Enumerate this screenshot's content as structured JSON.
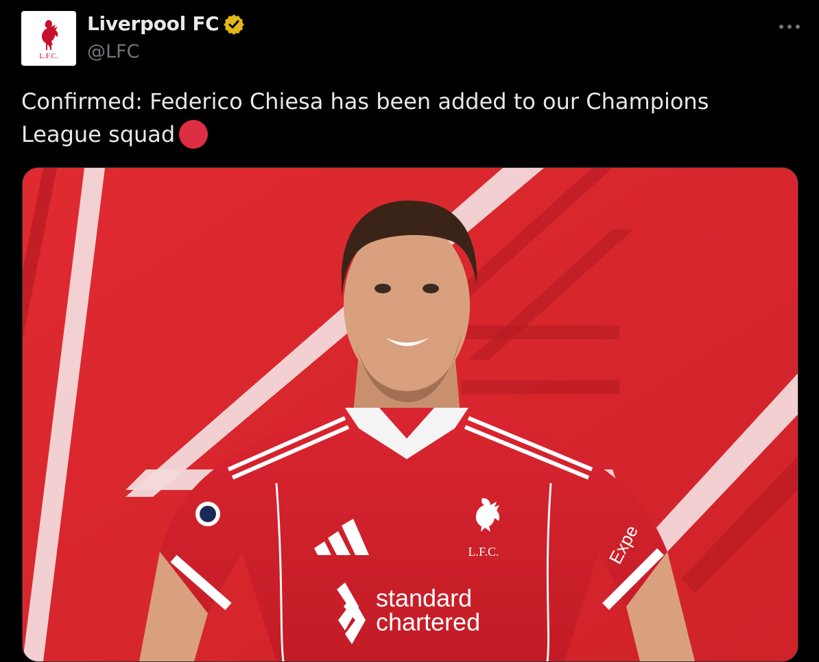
{
  "tweet": {
    "author": {
      "display_name": "Liverpool FC",
      "handle": "@LFC",
      "verified": true,
      "verified_badge_color": "#e2b719",
      "avatar_icon": "lfc-crest-icon",
      "avatar_text": "L.F.C."
    },
    "text": "Confirmed: Federico Chiesa has been added to our Champions League squad",
    "emoji": "red-circle",
    "more_icon": "more-dots-icon",
    "media": {
      "kind": "photo",
      "shirt_crest_text": "L.F.C.",
      "sponsor_line1": "standard",
      "sponsor_line2": "chartered",
      "sleeve_sponsor": "Expe",
      "accent_color": "#d8262d"
    }
  }
}
